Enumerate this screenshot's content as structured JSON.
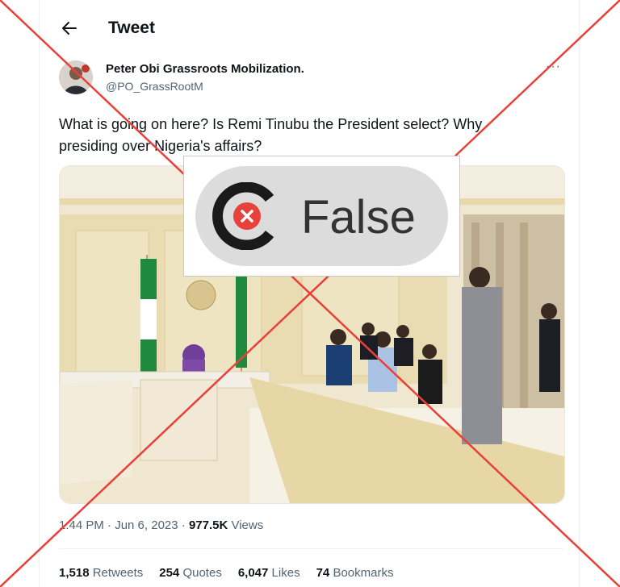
{
  "header": {
    "title": "Tweet"
  },
  "author": {
    "name": "Peter Obi Grassroots Mobilization.",
    "handle": "@PO_GrassRootM"
  },
  "tweet": {
    "text": "What is going on here? Is Remi Tinubu the President select? Why presiding over Nigeria's affairs?"
  },
  "meta": {
    "timestamp": "1:44 PM · Jun 6, 2023 ·",
    "views_count": "977.5K",
    "views_label": "Views"
  },
  "stats": [
    {
      "count": "1,518",
      "label": "Retweets"
    },
    {
      "count": "254",
      "label": "Quotes"
    },
    {
      "count": "6,047",
      "label": "Likes"
    },
    {
      "count": "74",
      "label": "Bookmarks"
    }
  ],
  "verdict": {
    "label": "False",
    "color": "#333333",
    "accent": "#e8403a"
  },
  "colors": {
    "cross": "#e8403a",
    "secondary_text": "#536471"
  },
  "icons": {
    "back": "arrow-left-icon",
    "more": "more-dots-icon",
    "verdict": "fact-check-x-icon"
  }
}
